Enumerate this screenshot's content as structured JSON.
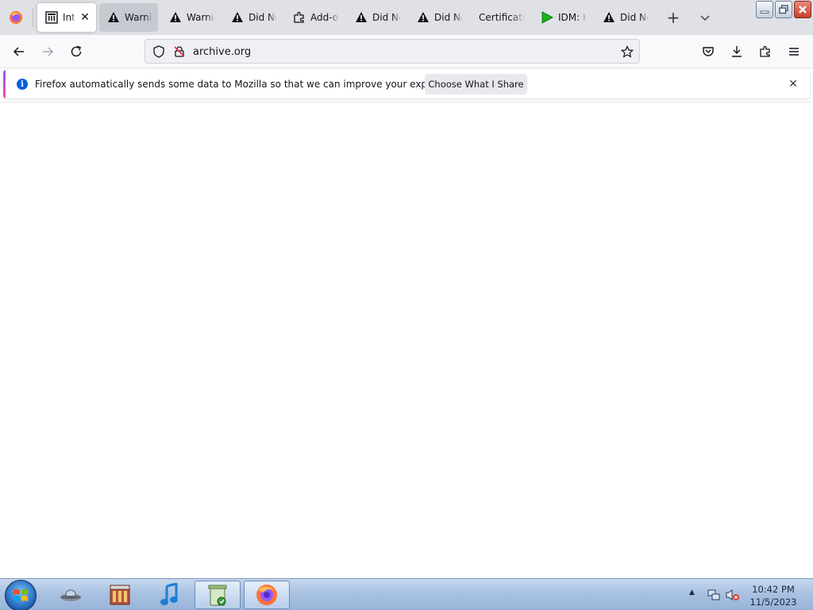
{
  "tabs": [
    {
      "label": "Internet Archive",
      "icon": "archive-icon",
      "active": true
    },
    {
      "label": "Warning",
      "icon": "warning-icon",
      "hover": true
    },
    {
      "label": "Warning",
      "icon": "warning-icon"
    },
    {
      "label": "Did Not Connect",
      "icon": "warning-icon"
    },
    {
      "label": "Add-ons",
      "icon": "puzzle-icon"
    },
    {
      "label": "Did Not Connect",
      "icon": "warning-icon"
    },
    {
      "label": "Did Not Connect",
      "icon": "warning-icon"
    },
    {
      "label": "Certificate",
      "icon": "none"
    },
    {
      "label": "IDM: H",
      "icon": "idm-icon"
    },
    {
      "label": "Did Not Connect",
      "icon": "warning-icon"
    }
  ],
  "urlbar": {
    "value": "archive.org"
  },
  "notification": {
    "message": "Firefox automatically sends some data to Mozilla so that we can improve your experience.",
    "button": "Choose What I Share"
  },
  "taskbar": {
    "apps": [
      "ufo-app",
      "archive-app",
      "music-app",
      "recycle-app",
      "firefox-app"
    ]
  },
  "clock": {
    "time": "10:42 PM",
    "date": "11/5/2023"
  },
  "colors": {
    "accent": "#0060df",
    "tabstrip": "#dfe1e6",
    "taskbar": "#a9c2e2"
  }
}
